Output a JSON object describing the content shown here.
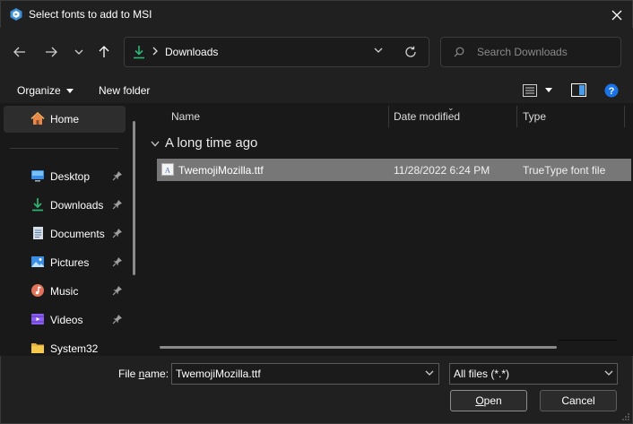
{
  "window": {
    "title": "Select fonts to add to MSI"
  },
  "address_bar": {
    "location": "Downloads"
  },
  "search": {
    "placeholder": "Search Downloads"
  },
  "command_bar": {
    "organize_label": "Organize",
    "new_folder_label": "New folder"
  },
  "sidebar": {
    "home_label": "Home",
    "items": [
      {
        "label": "Desktop",
        "icon": "desktop-icon",
        "pinned": true
      },
      {
        "label": "Downloads",
        "icon": "download-icon",
        "pinned": true
      },
      {
        "label": "Documents",
        "icon": "documents-icon",
        "pinned": true
      },
      {
        "label": "Pictures",
        "icon": "pictures-icon",
        "pinned": true
      },
      {
        "label": "Music",
        "icon": "music-icon",
        "pinned": true
      },
      {
        "label": "Videos",
        "icon": "videos-icon",
        "pinned": true
      },
      {
        "label": "System32",
        "icon": "folder-icon",
        "pinned": false
      }
    ]
  },
  "file_list": {
    "columns": [
      "Name",
      "Date modified",
      "Type"
    ],
    "group_label": "A long time ago",
    "rows": [
      {
        "name": "TwemojiMozilla.ttf",
        "date_modified": "11/28/2022 6:24 PM",
        "type": "TrueType font file",
        "selected": true
      }
    ]
  },
  "footer": {
    "file_name_label_prefix": "File ",
    "file_name_label_underlined": "n",
    "file_name_label_suffix": "ame:",
    "file_name_value": "TwemojiMozilla.ttf",
    "file_type_value": "All files (*.*)",
    "open_label_underlined": "O",
    "open_label_rest": "pen",
    "cancel_label": "Cancel"
  },
  "colors": {
    "background": "#191919",
    "chrome": "#202020",
    "selection": "#777777",
    "accent_download": "#2bb673",
    "help_blue": "#1a73e8"
  }
}
